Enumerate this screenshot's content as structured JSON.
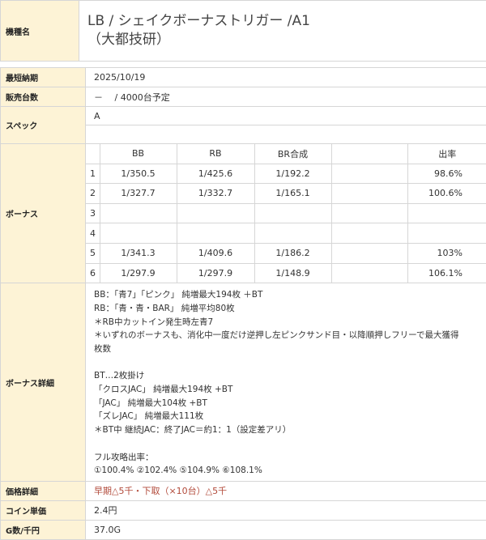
{
  "header": {
    "label": "機種名",
    "title_line1": "LB / シェイクボーナストリガー /A1",
    "title_line2": "（大都技研）"
  },
  "rows": {
    "release": {
      "label": "最短納期",
      "value": "2025/10/19"
    },
    "sales": {
      "label": "販売台数",
      "value": "－　 / 4000台予定"
    },
    "spec": {
      "label": "スペック",
      "value": "A",
      "value2": ""
    },
    "bonus": {
      "label": "ボーナス",
      "headers": [
        "",
        "BB",
        "RB",
        "BR合成",
        "",
        "出率"
      ],
      "settings": [
        {
          "n": "1",
          "bb": "1/350.5",
          "rb": "1/425.6",
          "br": "1/192.2",
          "extra": "",
          "rate": "98.6%"
        },
        {
          "n": "2",
          "bb": "1/327.7",
          "rb": "1/332.7",
          "br": "1/165.1",
          "extra": "",
          "rate": "100.6%"
        },
        {
          "n": "3",
          "bb": "",
          "rb": "",
          "br": "",
          "extra": "",
          "rate": ""
        },
        {
          "n": "4",
          "bb": "",
          "rb": "",
          "br": "",
          "extra": "",
          "rate": ""
        },
        {
          "n": "5",
          "bb": "1/341.3",
          "rb": "1/409.6",
          "br": "1/186.2",
          "extra": "",
          "rate": "103%"
        },
        {
          "n": "6",
          "bb": "1/297.9",
          "rb": "1/297.9",
          "br": "1/148.9",
          "extra": "",
          "rate": "106.1%"
        }
      ]
    },
    "detail": {
      "label": "ボーナス詳細",
      "lines": [
        "BB：「青7」「ピンク」 純増最大194枚 ＋BT",
        "RB：「青・青・BAR」 純増平均80枚",
        "＊RB中カットイン発生時左青7",
        "＊いずれのボーナスも、消化中一度だけ逆押し左ピンクサンド目・以降順押しフリーで最大獲得",
        "枚数",
        "",
        "BT…2枚掛け",
        "「クロスJAC」 純増最大194枚 +BT",
        "「JAC」 純増最大104枚 +BT",
        "「ズレJAC」 純増最大111枚",
        "＊BT中 継続JAC：終了JAC＝約1：1（設定差アリ）",
        "",
        "フル攻略出率：",
        "①100.4% ②102.4% ⑤104.9% ⑥108.1%"
      ]
    },
    "price": {
      "label": "価格詳細",
      "value": "早期△5千・下取（×10台）△5千"
    },
    "coin": {
      "label": "コイン単価",
      "value": "2.4円"
    },
    "g_per_1000": {
      "label": "G数/千円",
      "value": "37.0G"
    }
  }
}
